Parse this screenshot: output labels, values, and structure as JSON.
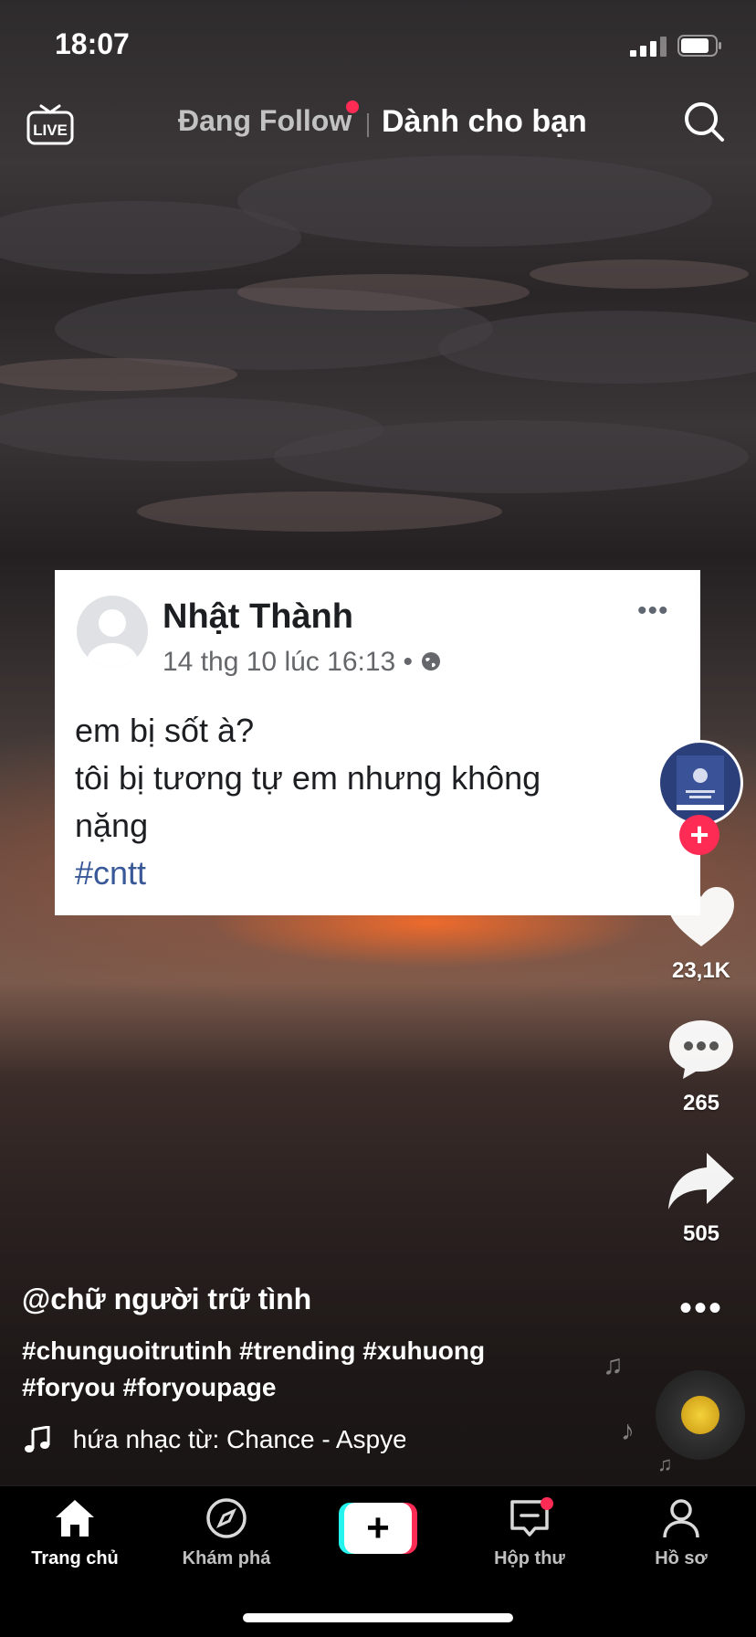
{
  "status_bar": {
    "time": "18:07"
  },
  "top_nav": {
    "live_label": "LIVE",
    "tab_following": "Đang Follow",
    "tab_for_you": "Dành cho bạn"
  },
  "post_card": {
    "author_name": "Nhật Thành",
    "timestamp": "14 thg 10 lúc 16:13 •",
    "more_label": "•••",
    "lines": [
      "em bị sốt à?",
      "tôi bị tương tự em nhưng không",
      "nặng"
    ],
    "hashtag": "#cntt"
  },
  "side_actions": {
    "likes": "23,1K",
    "comments": "265",
    "shares": "505"
  },
  "caption": {
    "username": "@chữ người trữ tình",
    "hashtags_line1": "#chunguoitrutinh #trending #xuhuong",
    "hashtags_line2": "#foryou #foryoupage",
    "music": "hứa nhạc từ: Chance - Aspye"
  },
  "bottom_nav": {
    "home": "Trang chủ",
    "discover": "Khám phá",
    "inbox": "Hộp thư",
    "profile": "Hồ sơ"
  },
  "colors": {
    "accent": "#fe2c55",
    "create_cyan": "#25f4ee",
    "hashtag_blue": "#385898"
  }
}
